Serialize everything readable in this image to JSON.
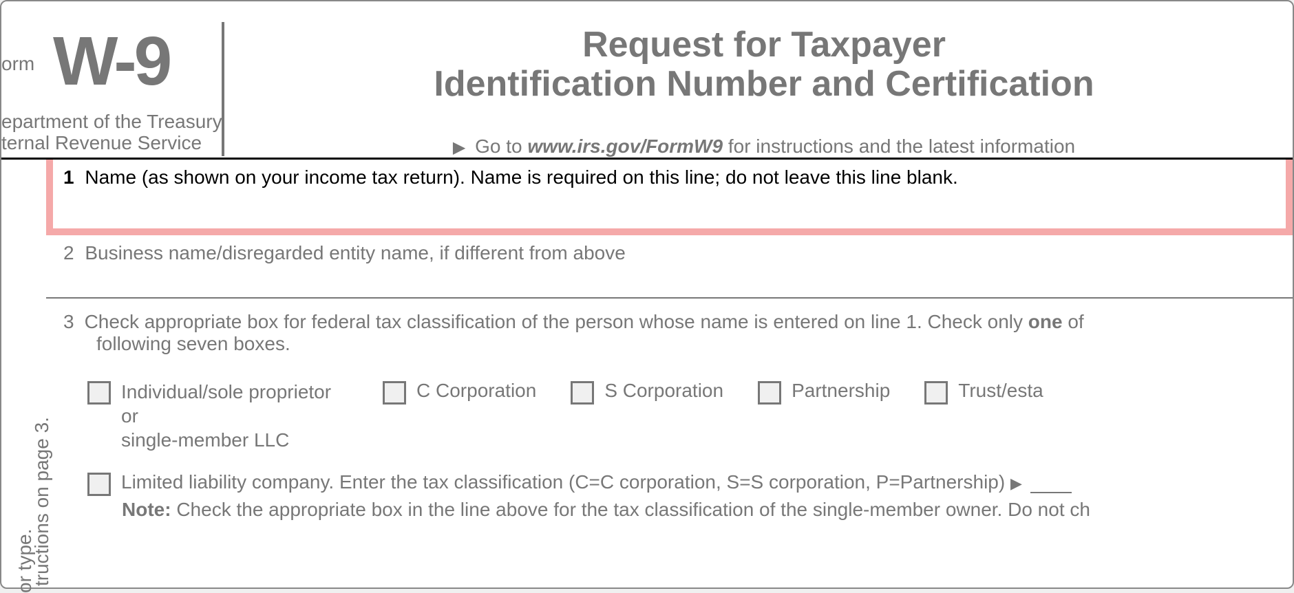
{
  "header": {
    "form_label": "orm",
    "form_code": "W-9",
    "dept_line1": "epartment of the Treasury",
    "dept_line2": "ternal Revenue Service",
    "title_line1": "Request for Taxpayer",
    "title_line2": "Identification Number and Certification",
    "goto_prefix": "Go to ",
    "goto_italic": "www.irs.gov/FormW9",
    "goto_suffix": " for instructions and the latest information"
  },
  "sidebar": {
    "partial1": "or type.",
    "partial2": "tructions on page 3."
  },
  "row1": {
    "num": "1",
    "text": "Name (as shown on your income tax return). Name is required on this line; do not leave this line blank."
  },
  "row2": {
    "num": "2",
    "text": "Business name/disregarded entity name, if different from above"
  },
  "row3": {
    "num": "3",
    "text_part1": "Check appropriate box for federal tax classification of the person whose name is entered on line 1. Check only ",
    "bold_one": "one",
    "text_part2": " of",
    "text_part3": "following seven boxes."
  },
  "checkboxes": {
    "cb1a": "Individual/sole proprietor or",
    "cb1b": "single-member LLC",
    "cb2": "C Corporation",
    "cb3": "S Corporation",
    "cb4": "Partnership",
    "cb5": "Trust/esta"
  },
  "llc": {
    "text": "Limited liability company. Enter the tax classification (C=C corporation, S=S corporation, P=Partnership)"
  },
  "note": {
    "bold": "Note:",
    "text": " Check the appropriate box in the line above for the tax classification of the single-member owner.  Do not ch"
  }
}
